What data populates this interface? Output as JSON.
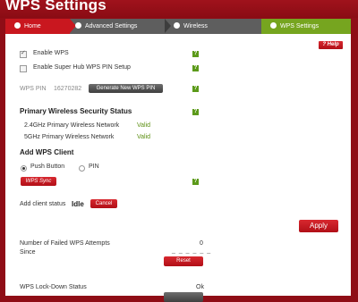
{
  "app": {
    "title": "WPS Settings"
  },
  "breadcrumb": [
    {
      "label": "Home"
    },
    {
      "label": "Advanced Settings"
    },
    {
      "label": "Wireless"
    },
    {
      "label": "WPS Settings"
    }
  ],
  "help": {
    "label": "? Help"
  },
  "enable_wps": {
    "label": "Enable WPS",
    "checked": true
  },
  "enable_superhub_pin": {
    "label": "Enable Super Hub WPS PIN Setup",
    "checked": false
  },
  "wps_pin": {
    "label": "WPS PIN",
    "value": "16270282",
    "generate_label": "Generate New WPS PIN"
  },
  "security_status": {
    "heading": "Primary Wireless Security Status",
    "rows": [
      {
        "label": "2.4GHz Primary Wireless Network",
        "value": "Valid"
      },
      {
        "label": "5GHz Primary Wireless Network",
        "value": "Valid"
      }
    ]
  },
  "add_client": {
    "heading": "Add WPS Client",
    "options": [
      {
        "label": "Push Button",
        "selected": true
      },
      {
        "label": "PIN",
        "selected": false
      }
    ],
    "sync_label": "WPS Sync",
    "status_label": "Add client status",
    "status_value": "Idle",
    "cancel_label": "Cancel"
  },
  "apply_label": "Apply",
  "failed_attempts": {
    "label_line1": "Number of Failed WPS Attempts",
    "label_line2": "Since",
    "value": "0",
    "reset_label": "Reset"
  },
  "lockdown": {
    "label": "WPS Lock-Down Status",
    "value": "Ok"
  },
  "help_icon_glyph": "?",
  "colors": {
    "brand_red": "#8f0d16",
    "accent_green": "#76a51f",
    "valid_green": "#5c8f12"
  }
}
